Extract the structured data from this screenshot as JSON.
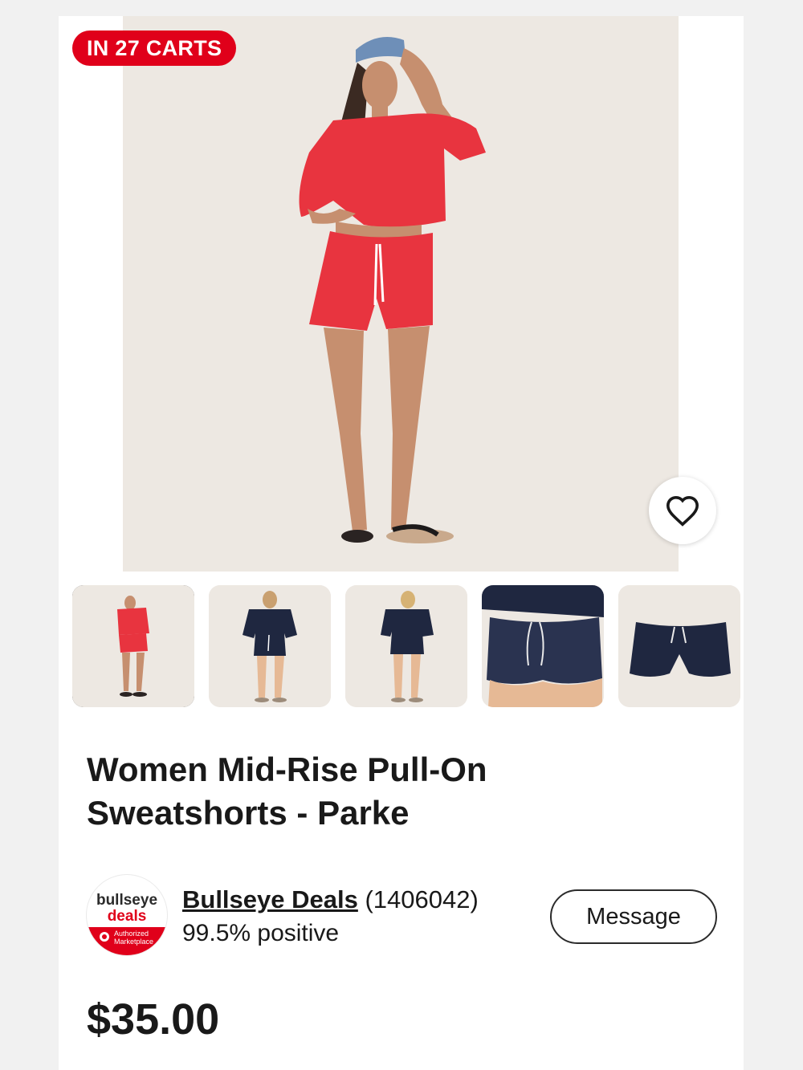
{
  "product": {
    "badge": "IN 27 CARTS",
    "title": "Women Mid-Rise Pull-On Sweatshorts - Parke",
    "price": "$35.00",
    "favorite_icon": "heart-outline-icon",
    "gallery": {
      "selected_index": 0,
      "thumbnails": [
        {
          "view": "model-front-red"
        },
        {
          "view": "model-front-navy"
        },
        {
          "view": "model-back-navy"
        },
        {
          "view": "closeup-navy-shorts"
        },
        {
          "view": "flat-lay-navy-shorts"
        }
      ]
    }
  },
  "seller": {
    "logo": {
      "line1": "bullseye",
      "line2": "deals",
      "tag": "Authorized Marketplace"
    },
    "name": "Bullseye Deals",
    "feedback_count": "(1406042)",
    "feedback_percent": "99.5% positive",
    "message_label": "Message"
  },
  "colors": {
    "accent_red": "#e0001a",
    "garment_red": "#e8343f",
    "garment_navy": "#1f2740",
    "photo_background": "#ede8e2"
  }
}
